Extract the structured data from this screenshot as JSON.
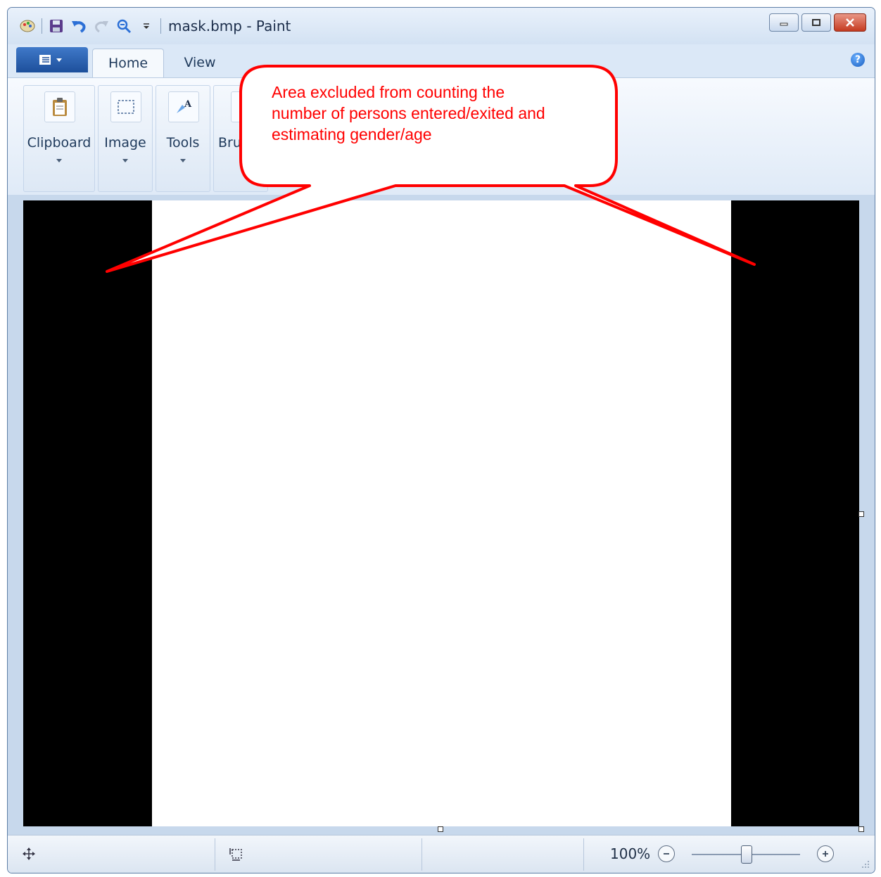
{
  "window": {
    "title": "mask.bmp - Paint",
    "accent": "#5d7ea6",
    "buttons": [
      "minimize-icon",
      "maximize-icon",
      "close-icon"
    ]
  },
  "quick_access": {
    "icons": [
      "paint-app-icon",
      "save-icon",
      "undo-icon",
      "redo-icon",
      "zoom-icon",
      "customize-dropdown-icon"
    ]
  },
  "ribbon": {
    "tabs": [
      {
        "label": "Home",
        "active": true
      },
      {
        "label": "View",
        "active": false
      }
    ],
    "groups": [
      {
        "label": "Clipboard",
        "icon": "clipboard-icon"
      },
      {
        "label": "Image",
        "icon": "select-icon"
      },
      {
        "label": "Tools",
        "icon": "tools-icon"
      },
      {
        "label": "Bru",
        "icon": "brushes-icon"
      }
    ]
  },
  "canvas": {
    "mask_color": "#000000",
    "background": "#ffffff"
  },
  "statusbar": {
    "zoom": "100%",
    "icons": [
      "cursor-position-icon",
      "selection-size-icon",
      "zoom-out-icon",
      "zoom-in-icon"
    ]
  },
  "callout": {
    "lines": [
      "Area excluded from counting the",
      "number of persons entered/exited and",
      "estimating gender/age"
    ],
    "color": "#ff0000"
  }
}
